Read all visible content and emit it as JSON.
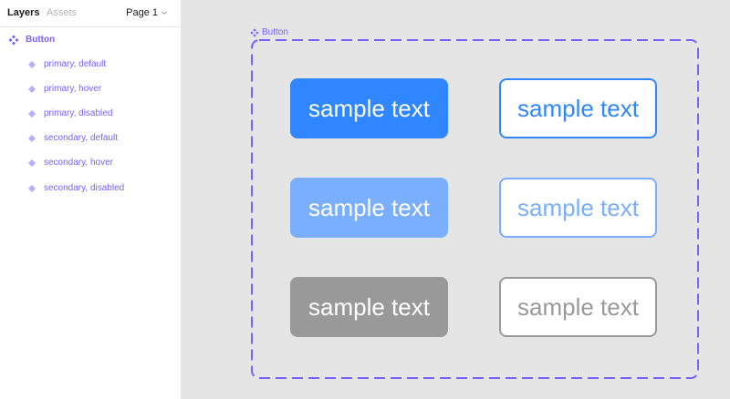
{
  "sidebar": {
    "tabs": {
      "layers": "Layers",
      "assets": "Assets"
    },
    "page_select": "Page 1",
    "component": {
      "label": "Button",
      "icon": "component-icon",
      "variants": [
        {
          "label": "primary, default",
          "icon": "variant-diamond-icon"
        },
        {
          "label": "primary, hover",
          "icon": "variant-diamond-icon"
        },
        {
          "label": "primary, disabled",
          "icon": "variant-diamond-icon"
        },
        {
          "label": "secondary, default",
          "icon": "variant-diamond-icon"
        },
        {
          "label": "secondary, hover",
          "icon": "variant-diamond-icon"
        },
        {
          "label": "secondary, disabled",
          "icon": "variant-diamond-icon"
        }
      ]
    }
  },
  "canvas": {
    "frame_label": "Button",
    "frame_icon": "component-icon",
    "buttons": {
      "primary_default": "sample text",
      "secondary_default": "sample text",
      "primary_hover": "sample text",
      "secondary_hover": "sample text",
      "primary_disabled": "sample text",
      "secondary_disabled": "sample text"
    }
  },
  "colors": {
    "accent_purple": "#7b61ff",
    "primary_default_bg": "#2f86ff",
    "primary_hover_bg": "#7aaeff",
    "primary_disabled_bg": "#999999",
    "secondary_default_border": "#2f86ff",
    "secondary_hover_border": "#7aaeff",
    "secondary_disabled_border": "#999999",
    "canvas_bg": "#e5e5e5",
    "sidebar_bg": "#ffffff"
  }
}
